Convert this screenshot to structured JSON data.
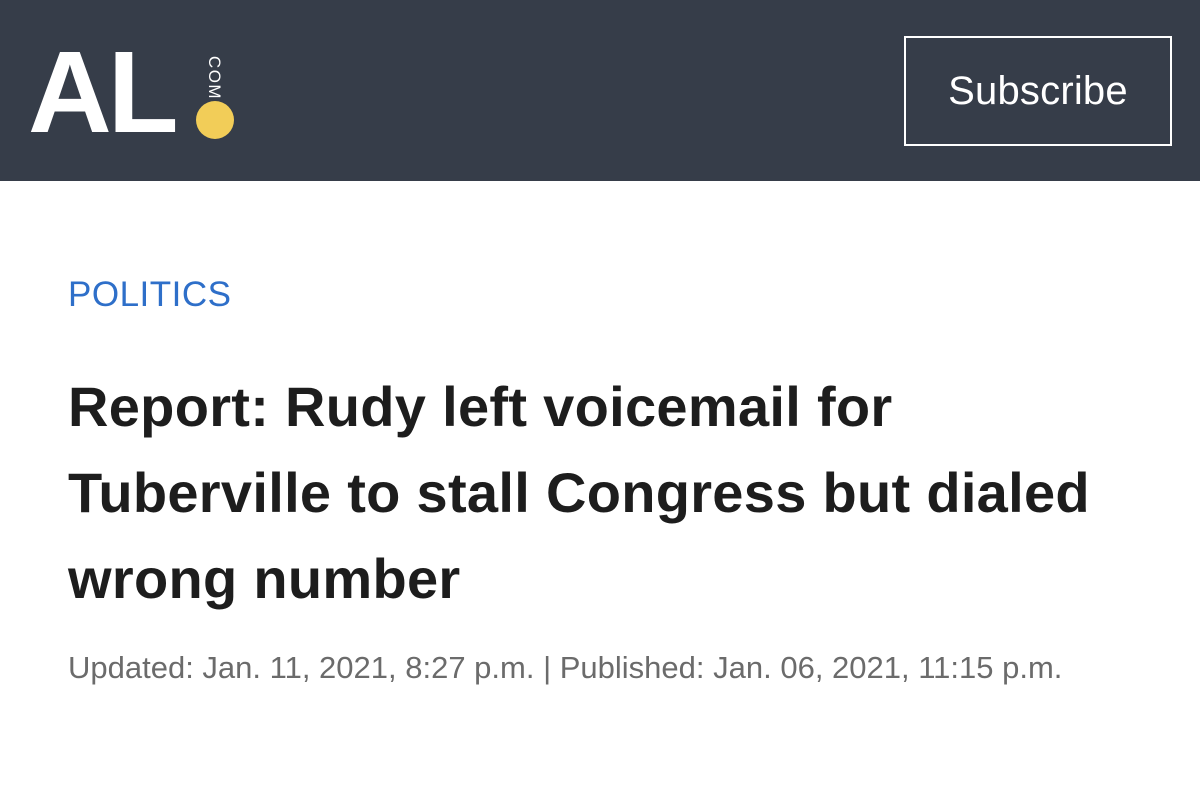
{
  "header": {
    "logo": {
      "main_text": "AL",
      "suffix_text": "COM",
      "dot_color": "#f2cd58"
    },
    "subscribe_label": "Subscribe",
    "background_color": "#363d49"
  },
  "article": {
    "section": "POLITICS",
    "section_color": "#2e6fc9",
    "headline": "Report: Rudy left voicemail for Tuberville to stall Congress but dialed wrong number",
    "timestamp": "Updated: Jan. 11, 2021, 8:27 p.m. | Published: Jan. 06, 2021, 11:15 p.m."
  }
}
